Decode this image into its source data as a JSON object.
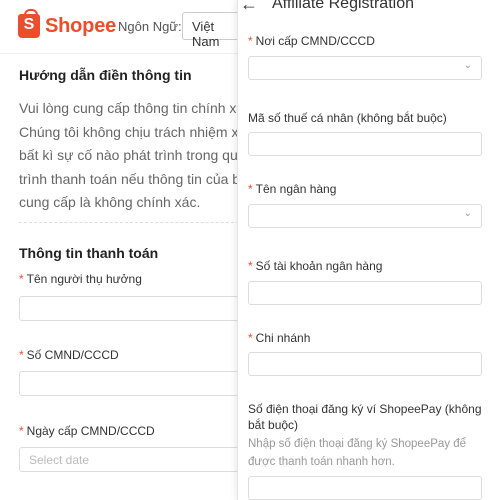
{
  "header": {
    "logo_text": "Shopee",
    "logo_glyph": "S",
    "language_label": "Ngôn Ngữ:",
    "language_value": "Việt Nam"
  },
  "guide": {
    "title": "Hướng dẫn điền thông tin",
    "lines": [
      "Vui lòng cung cấp thông tin chính x",
      "Chúng tôi không chịu trách nhiệm x",
      "bất kì sự cố nào phát trình trong qu",
      "trình thanh toán nếu thông tin của b",
      "cung cấp là không chính xác."
    ]
  },
  "payment": {
    "title": "Thông tin thanh toán",
    "fields": {
      "beneficiary_label": "Tên người thụ hưởng",
      "id_label": "Số CMND/CCCD",
      "issue_date_label": "Ngày cấp CMND/CCCD",
      "issue_date_placeholder": "Select date"
    }
  },
  "drawer": {
    "title": "Affiliate Registration",
    "fields": {
      "issue_place_label": "Nơi cấp CMND/CCCD",
      "tax_label": "Mã số thuế cá nhân (không bắt buộc)",
      "bank_name_label": "Tên ngân hàng",
      "account_label": "Số tài khoản ngân hàng",
      "branch_label": "Chi nhánh",
      "shopeepay_label": "Số điện thoại đăng ký ví ShopeePay (không bắt buộc)",
      "shopeepay_hint": "Nhập số điện thoại đăng ký ShopeePay để được thanh toán nhanh hơn."
    }
  },
  "colors": {
    "brand": "#ee4d2d",
    "required_star": "#ee4d2d"
  },
  "icons": {
    "back": "arrow-left-icon",
    "dropdown": "chevron-down-icon"
  }
}
